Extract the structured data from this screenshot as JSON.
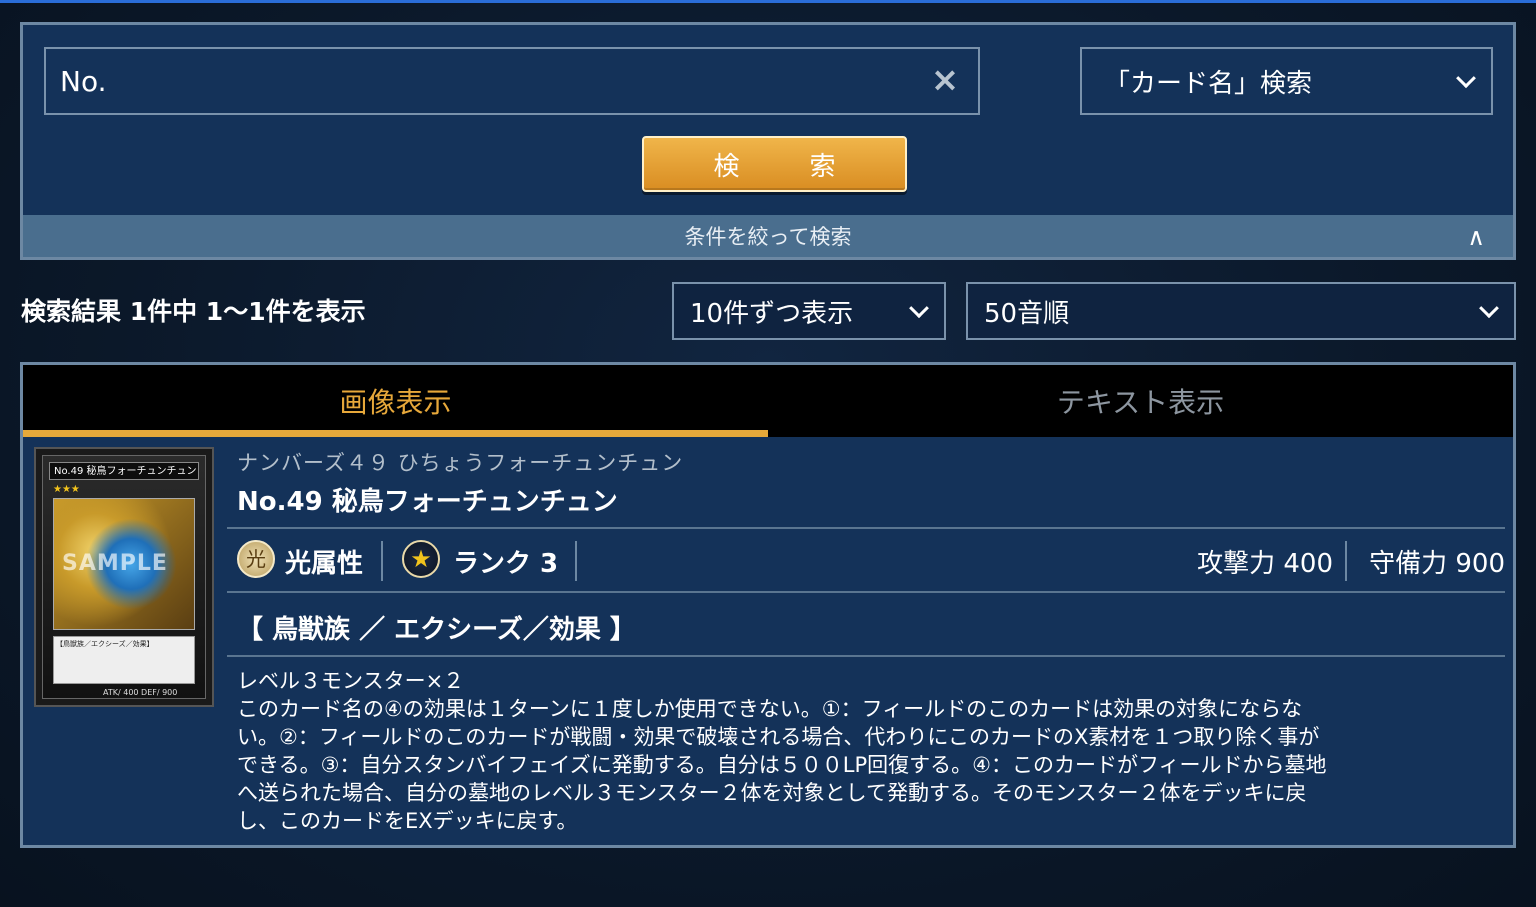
{
  "search": {
    "keyword_value": "No.",
    "clear_icon": "close-icon",
    "search_type": "「カード名」検索",
    "button_label": "検　索",
    "filter_label": "条件を絞って検索",
    "filter_caret": "∧"
  },
  "results": {
    "count_text": "検索結果 1件中 1〜1件を表示",
    "per_page": "10件ずつ表示",
    "sort": "50音順"
  },
  "tabs": {
    "image_view": "画像表示",
    "text_view": "テキスト表示"
  },
  "card": {
    "kana": "ナンバーズ４９ ひちょうフォーチュンチュン",
    "name": "No.49 秘鳥フォーチュンチュン",
    "attribute_icon_text": "光",
    "attribute": "光属性",
    "rank_icon": "star-icon",
    "rank": "ランク 3",
    "atk": "攻撃力 400",
    "def": "守備力 900",
    "type_line": "【 鳥獣族 ／ エクシーズ／効果 】",
    "effect_lines": [
      "レベル３モンスター×２",
      "このカード名の④の効果は１ターンに１度しか使用できない。①：フィールドのこのカードは効果の対象にならな",
      "い。②：フィールドのこのカードが戦闘・効果で破壊される場合、代わりにこのカードのX素材を１つ取り除く事が",
      "できる。③：自分スタンバイフェイズに発動する。自分は５００LP回復する。④：このカードがフィールドから墓地",
      "へ送られた場合、自分の墓地のレベル３モンスター２体を対象として発動する。そのモンスター２体をデッキに戻",
      "し、このカードをEXデッキに戻す。"
    ],
    "thumb": {
      "name": "No.49 秘鳥フォーチュンチュン",
      "stars": "★★★",
      "watermark": "SAMPLE",
      "type": "【鳥獣族／エクシーズ／効果】",
      "stats": "ATK/ 400 DEF/ 900"
    }
  }
}
